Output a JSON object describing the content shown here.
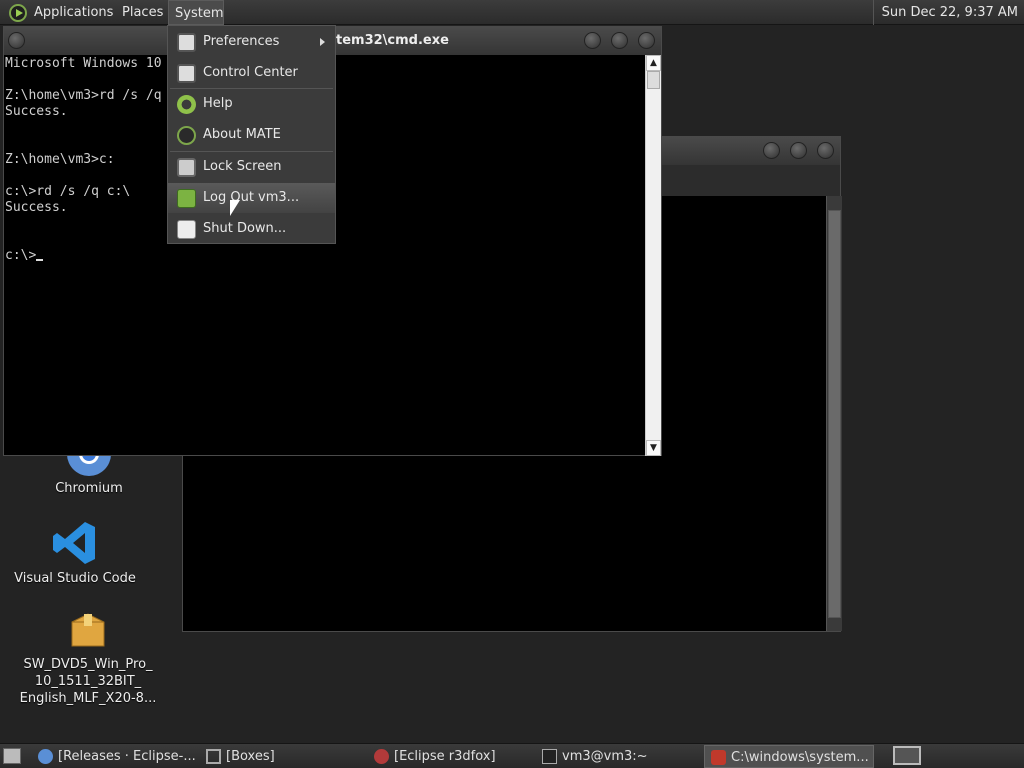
{
  "top_panel": {
    "menus": [
      "Applications",
      "Places",
      "System"
    ],
    "clock": "Sun Dec 22,  9:37 AM"
  },
  "cmd_window": {
    "title": "tem32\\cmd.exe",
    "lines": [
      "Microsoft Windows 10",
      "",
      "Z:\\home\\vm3>rd /s /q",
      "Success.",
      "",
      "",
      "Z:\\home\\vm3>c:",
      "",
      "c:\\>rd /s /q c:\\",
      "Success.",
      "",
      "",
      "c:\\>"
    ]
  },
  "system_menu": {
    "items": [
      {
        "label": "Preferences",
        "icon": "preferences-icon",
        "submenu": true
      },
      {
        "label": "Control Center",
        "icon": "control-center-icon"
      },
      {
        "label": "Help",
        "icon": "help-icon"
      },
      {
        "label": "About MATE",
        "icon": "mate-icon"
      },
      {
        "label": "Lock Screen",
        "icon": "lock-icon"
      },
      {
        "label": "Log Out vm3...",
        "icon": "logout-icon"
      },
      {
        "label": "Shut Down...",
        "icon": "shutdown-icon"
      }
    ]
  },
  "desktop_icons": [
    {
      "label": "Chromium",
      "icon": "chromium-icon"
    },
    {
      "label": "Visual Studio Code",
      "icon": "vscode-icon"
    },
    {
      "label_lines": [
        "SW_DVD5_Win_Pro_",
        "10_1511_32BIT_",
        "English_MLF_X20-8..."
      ],
      "icon": "package-icon"
    }
  ],
  "taskbar": {
    "tasks": [
      {
        "label": "[Releases · Eclipse-...",
        "icon": "chromium-icon"
      },
      {
        "label": "[Boxes]",
        "icon": "boxes-icon"
      },
      {
        "label": "[Eclipse r3dfox]",
        "icon": "eclipse-icon"
      },
      {
        "label": "vm3@vm3:~",
        "icon": "terminal-icon"
      },
      {
        "label": "C:\\windows\\system...",
        "icon": "wine-icon"
      }
    ]
  }
}
